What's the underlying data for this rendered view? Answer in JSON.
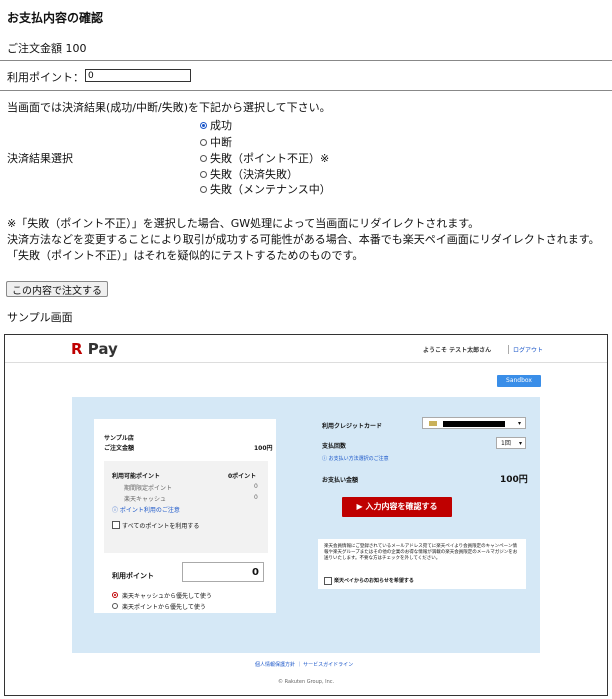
{
  "header": {
    "title": "お支払内容の確認"
  },
  "order": {
    "amount_label": "ご注文金額 100"
  },
  "points": {
    "label": "利用ポイント：",
    "value": "0"
  },
  "result": {
    "instruction": "当画面では決済結果(成功/中断/失敗)を下記から選択して下さい。",
    "label": "決済結果選択",
    "options": [
      {
        "label": "成功",
        "selected": true
      },
      {
        "label": "中断",
        "selected": false
      },
      {
        "label": "失敗（ポイント不正）※",
        "selected": false
      },
      {
        "label": "失敗（決済失敗）",
        "selected": false
      },
      {
        "label": "失敗（メンテナンス中）",
        "selected": false
      }
    ]
  },
  "notes": {
    "line1": "※「失敗（ポイント不正）」を選択した場合、GW処理によって当画面にリダイレクトされます。",
    "line2": "決済方法などを変更することにより取引が成功する可能性がある場合、本番でも楽天ペイ画面にリダイレクトされます。",
    "line3": "「失敗（ポイント不正）」はそれを疑似的にテストするためのものです。"
  },
  "actions": {
    "order_button": "この内容で注文する"
  },
  "sample": {
    "label": "サンプル画面",
    "logo_r": "R",
    "logo_pay": "Pay",
    "welcome": "ようこそ テスト太郎さん",
    "logout": "ログアウト",
    "sandbox": "Sandbox",
    "left": {
      "shop": "サンプル店",
      "order_amount_label": "ご注文金額",
      "order_amount_value": "100円",
      "available_points_label": "利用可能ポイント",
      "available_points_value": "0ポイント",
      "limited_points_label": "期間限定ポイント",
      "limited_points_value": "0",
      "cash_label": "楽天キャッシュ",
      "cash_value": "0",
      "points_note": "ポイント利用のご注意",
      "use_all": "すべてのポイントを利用する",
      "use_points_label": "利用ポイント",
      "use_points_value": "0",
      "opt_cash_first": "楽天キャッシュから優先して使う",
      "opt_points_first": "楽天ポイントから優先して使う"
    },
    "right": {
      "card_label": "利用クレジットカード",
      "installments_label": "支払回数",
      "installments_value": "1回",
      "payment_note": "お支払い方法選択のご注意",
      "total_label": "お支払い金額",
      "total_value": "100円",
      "confirm_button": "入力内容を確認する",
      "newsletter_text": "楽天会員情報にご登録されているメールアドレス宛てに楽天ペイより会員限定のキャンペーン情報や楽天グループまたはその他の企業のお得な情報が満載の楽天会員限定のメールマガジンをお送りいたします。不要な方はチェックを外してください。",
      "newsletter_checkbox": "楽天ペイからのお知らせを希望する"
    },
    "footer_links": "個人情報保護方針 ｜ サービスガイドライン",
    "copyright": "© Rakuten Group, Inc."
  },
  "colors": {
    "brand_red": "#bf0000",
    "link_blue": "#1a56c9",
    "panel_bg": "#d5e8f6",
    "sandbox_blue": "#3a8ee8"
  }
}
